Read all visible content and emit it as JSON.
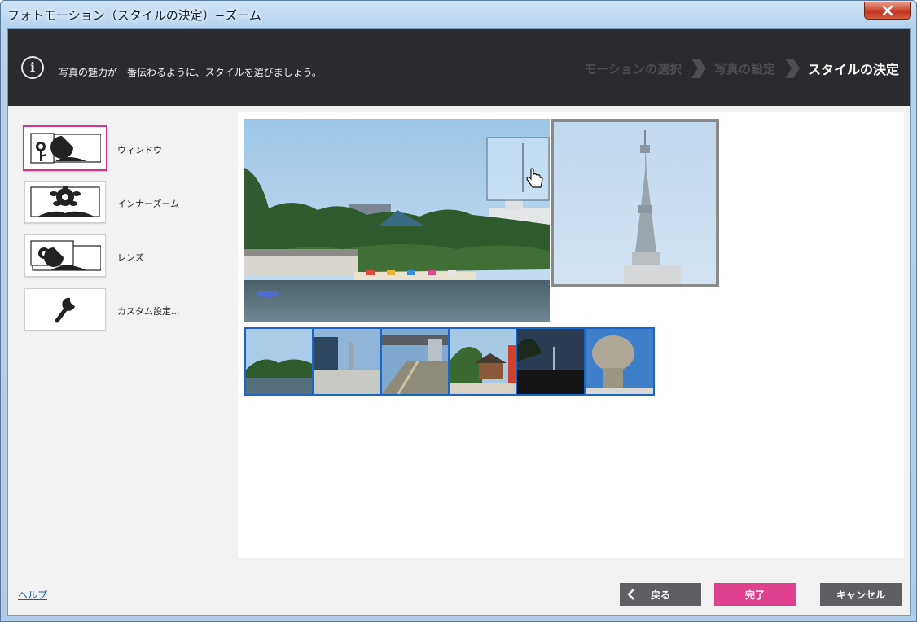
{
  "window": {
    "title": "フォトモーション（スタイルの決定）−ズーム"
  },
  "header": {
    "message": "写真の魅力が一番伝わるように、スタイルを選びましょう。",
    "steps": [
      "モーションの選択",
      "写真の設定",
      "スタイルの決定"
    ],
    "active_step": 2
  },
  "styles": [
    {
      "label": "ウィンドウ",
      "icon": "window-style-icon",
      "selected": true
    },
    {
      "label": "インナーズーム",
      "icon": "inner-zoom-icon",
      "selected": false
    },
    {
      "label": "レンズ",
      "icon": "lens-icon",
      "selected": false
    },
    {
      "label": "カスタム設定...",
      "icon": "wrench-icon",
      "selected": false
    }
  ],
  "footer": {
    "help": "ヘルプ",
    "back": "戻る",
    "done": "完了",
    "cancel": "キャンセル"
  },
  "colors": {
    "header_bg": "#2a2b2e",
    "accent_pink": "#e0418f",
    "selection_blue": "#1a65c7",
    "button_gray": "#5e5f62"
  }
}
